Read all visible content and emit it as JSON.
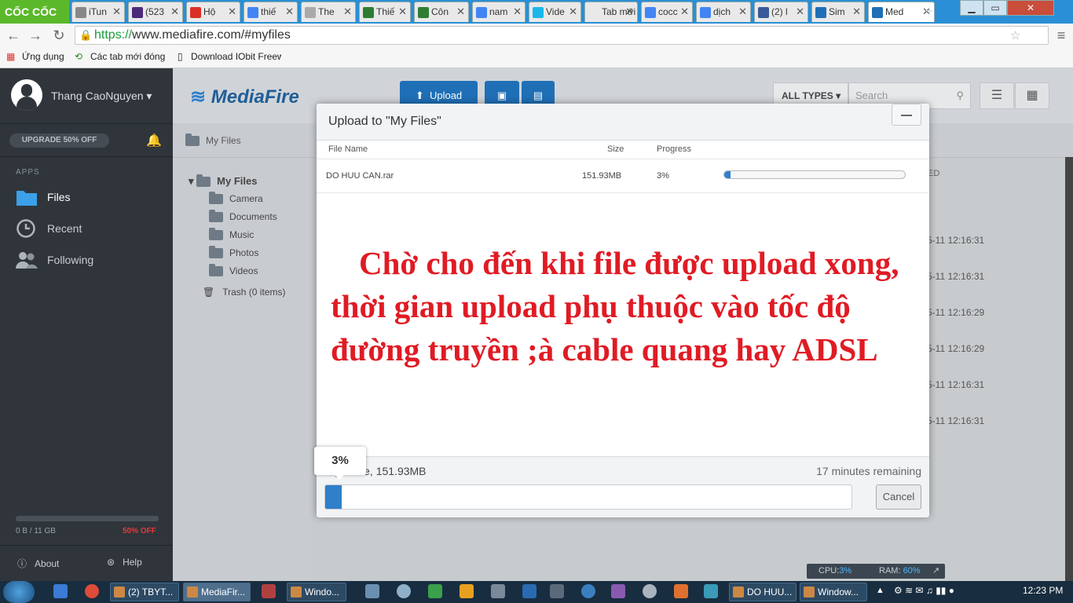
{
  "browser": {
    "brand": "CỐC CỐC",
    "tabs": [
      {
        "label": "iTun",
        "favicon_color": "#888888"
      },
      {
        "label": "(523",
        "favicon_color": "#4b2a7a"
      },
      {
        "label": "Hộ",
        "favicon_color": "#d93025"
      },
      {
        "label": "thiế",
        "favicon_color": "#4285f4"
      },
      {
        "label": "The",
        "favicon_color": "#aaaaaa"
      },
      {
        "label": "Thiế",
        "favicon_color": "#2e7d32"
      },
      {
        "label": "Côn",
        "favicon_color": "#2e7d32"
      },
      {
        "label": "nam",
        "favicon_color": "#4285f4"
      },
      {
        "label": "Vide",
        "favicon_color": "#1ab7ea"
      },
      {
        "label": "Tab mới",
        "favicon_color": "#e9e9e9"
      },
      {
        "label": "cocc",
        "favicon_color": "#4285f4"
      },
      {
        "label": "dịch",
        "favicon_color": "#4285f4"
      },
      {
        "label": "(2) l",
        "favicon_color": "#3b5998"
      },
      {
        "label": "Sim",
        "favicon_color": "#1f6fb6"
      },
      {
        "label": "Med",
        "favicon_color": "#1f6fb6"
      }
    ],
    "url_scheme": "https://",
    "url_rest": "www.mediafire.com/#myfiles",
    "bookmarks": [
      "Ứng dụng",
      "Các tab mới đóng",
      "Download IObit Freew"
    ]
  },
  "sidebar": {
    "username": "Thang CaoNguyen",
    "upgrade_label": "UPGRADE 50% OFF",
    "apps_label": "APPS",
    "nav": [
      {
        "label": "Files"
      },
      {
        "label": "Recent"
      },
      {
        "label": "Following"
      }
    ],
    "quota": "0 B / 11 GB",
    "quota_offer": "50% OFF",
    "about": "About",
    "help": "Help"
  },
  "header": {
    "logo": "MediaFire",
    "upload_label": "Upload",
    "type_filter": "ALL TYPES",
    "search_placeholder": "Search"
  },
  "breadcrumb": "My Files",
  "tree": {
    "root": "My Files",
    "folders": [
      "Camera",
      "Documents",
      "Music",
      "Photos",
      "Videos"
    ],
    "trash": "Trash (0 items)"
  },
  "filelist": {
    "col_fragment": "ED",
    "times": [
      "5-11 12:16:31",
      "5-11 12:16:31",
      "5-11 12:16:29",
      "5-11 12:16:29",
      "5-11 12:16:31",
      "5-11 12:16:31"
    ]
  },
  "modal": {
    "title": "Upload to \"My Files\"",
    "col_name": "File Name",
    "col_size": "Size",
    "col_progress": "Progress",
    "file": {
      "name": "DO HUU CAN.rar",
      "size": "151.93MB",
      "progress_text": "3%",
      "progress": 0.03
    },
    "note": "Chờ cho đến khi file được upload xong, thời gian upload phụ thuộc vào tốc độ đường truyền ;à cable quang hay ADSL",
    "status_left": "ng: 1 file, 151.93MB",
    "status_right": "17 minutes remaining",
    "overall_pct_text": "3%",
    "overall_progress": 0.03,
    "cancel_label": "Cancel"
  },
  "sysmon": {
    "cpu_label": "CPU:",
    "cpu_value": "3%",
    "ram_label": "RAM:",
    "ram_value": "60%"
  },
  "taskbar": {
    "items": [
      "(2) TBYT...",
      "MediaFir...",
      "Windo...",
      "DO HUU...",
      "Window..."
    ],
    "clock": "12:23 PM"
  },
  "colors": {
    "accent": "#1f6fb6",
    "note": "#e01b24",
    "sidebar": "#2f353b"
  }
}
